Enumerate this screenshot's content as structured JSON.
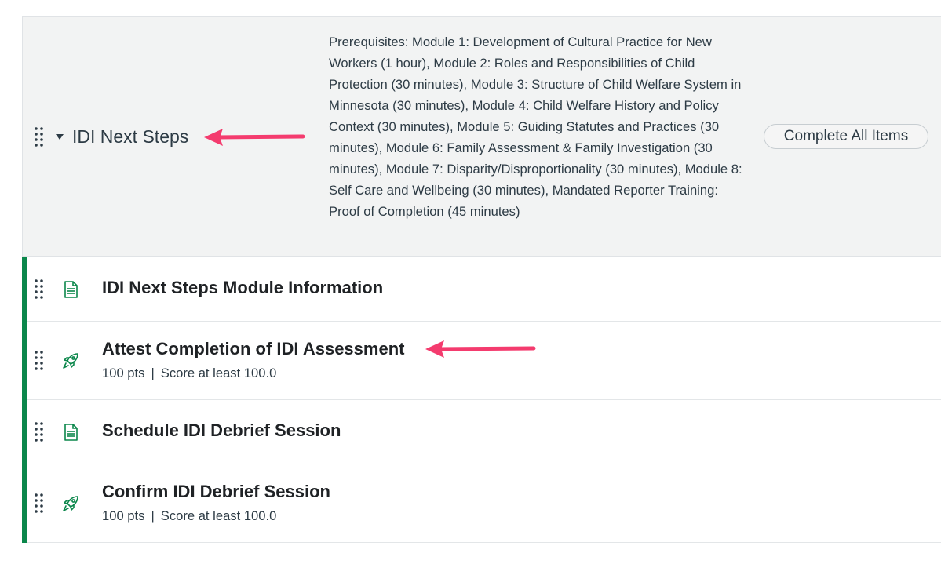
{
  "module": {
    "title": "IDI Next Steps",
    "prerequisites": "Prerequisites: Module 1: Development of Cultural Practice for New Workers (1 hour), Module 2: Roles and Responsibilities of Child Protection (30 minutes), Module 3: Structure of Child Welfare System in Minnesota (30 minutes), Module 4: Child Welfare History and Policy Context (30 minutes), Module 5: Guiding Statutes and Practices (30 minutes), Module 6: Family Assessment & Family Investigation (30 minutes), Module 7: Disparity/Disproportionality (30 minutes), Module 8: Self Care and Wellbeing (30 minutes), Mandated Reporter Training: Proof of Completion (45 minutes)",
    "complete_button": "Complete All Items"
  },
  "items": [
    {
      "title": "IDI Next Steps Module Information",
      "type_icon": "page-icon"
    },
    {
      "title": "Attest Completion of IDI Assessment",
      "type_icon": "quiz-rocket-icon",
      "points": "100 pts",
      "separator": "|",
      "requirement": "Score at least 100.0"
    },
    {
      "title": "Schedule IDI Debrief Session",
      "type_icon": "page-icon"
    },
    {
      "title": "Confirm IDI Debrief Session",
      "type_icon": "quiz-rocket-icon",
      "points": "100 pts",
      "separator": "|",
      "requirement": "Score at least 100.0"
    }
  ],
  "colors": {
    "accent_green": "#0b874b",
    "annotation_arrow": "#f43b6e",
    "header_bg": "#f2f3f3"
  }
}
